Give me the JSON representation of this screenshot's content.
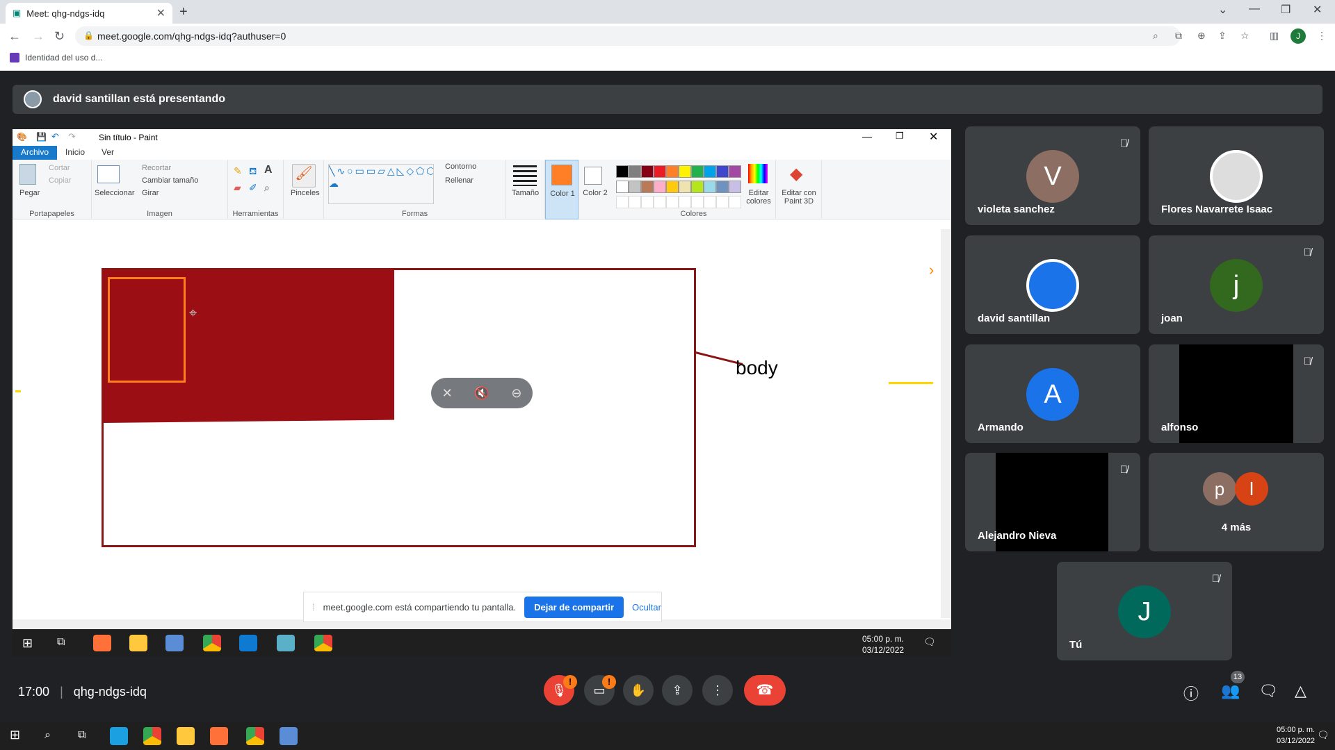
{
  "browser": {
    "tab_title": "Meet: qhg-ndgs-idq",
    "url": "meet.google.com/qhg-ndgs-idq?authuser=0",
    "bookmark": "Identidad del uso d...",
    "profile_initial": "J"
  },
  "meet": {
    "presenting_text": "david santillan está presentando",
    "time": "17:00",
    "meeting_code": "qhg-ndgs-idq",
    "participants_count": "13",
    "share_banner": {
      "text": "meet.google.com está compartiendo tu pantalla.",
      "stop_label": "Dejar de compartir",
      "hide_label": "Ocultar"
    },
    "tiles": [
      {
        "name": "violeta sanchez",
        "initial": "V",
        "color": "#8d6e63",
        "muted": true
      },
      {
        "name": "Flores Navarrete Isaac",
        "initial": "",
        "color": "#5f6368",
        "muted": false
      },
      {
        "name": "david santillan",
        "initial": "",
        "color": "#1a73e8",
        "muted": false
      },
      {
        "name": "joan",
        "initial": "j",
        "color": "#33691e",
        "muted": true
      },
      {
        "name": "Armando",
        "initial": "A",
        "color": "#1a73e8",
        "muted": false
      },
      {
        "name": "alfonso",
        "initial": "",
        "color": "#000000",
        "muted": true
      },
      {
        "name": "Alejandro Nieva",
        "initial": "",
        "color": "#000000",
        "muted": true
      },
      {
        "name": "4 más",
        "initial": "",
        "color": "#5f6368",
        "muted": false
      },
      {
        "name": "Tú",
        "initial": "J",
        "color": "#00695c",
        "muted": true
      }
    ],
    "more_avatars": [
      "p",
      "l"
    ]
  },
  "paint": {
    "title": "Sin título - Paint",
    "tabs": [
      "Archivo",
      "Inicio",
      "Ver"
    ],
    "groups": {
      "clipboard": {
        "label": "Portapapeles",
        "paste": "Pegar",
        "cut": "Cortar",
        "copy": "Copiar"
      },
      "image": {
        "label": "Imagen",
        "select": "Seleccionar",
        "crop": "Recortar",
        "resize": "Cambiar tamaño",
        "rotate": "Girar"
      },
      "tools": {
        "label": "Herramientas"
      },
      "brushes": {
        "label": "Pinceles"
      },
      "shapes": {
        "label": "Formas",
        "outline": "Contorno",
        "fill": "Rellenar"
      },
      "size": {
        "label": "Tamaño"
      },
      "color1": {
        "label": "Color 1"
      },
      "color2": {
        "label": "Color 2"
      },
      "colors": {
        "label": "Colores",
        "edit": "Editar colores"
      },
      "paint3d": {
        "label": "Editar con Paint 3D"
      }
    },
    "palette": [
      "#000000",
      "#7f7f7f",
      "#880015",
      "#ed1c24",
      "#ff7f27",
      "#fff200",
      "#22b14c",
      "#00a2e8",
      "#3f48cc",
      "#a349a4",
      "#ffffff",
      "#c3c3c3",
      "#b97a57",
      "#ffaec9",
      "#ffc90e",
      "#efe4b0",
      "#b5e61d",
      "#99d9ea",
      "#7092be",
      "#c8bfe7"
    ],
    "canvas_text": "body",
    "clock": {
      "time": "05:00 p. m.",
      "date": "03/12/2022"
    }
  },
  "windows": {
    "clock": {
      "time": "05:00 p. m.",
      "date": "03/12/2022"
    }
  }
}
